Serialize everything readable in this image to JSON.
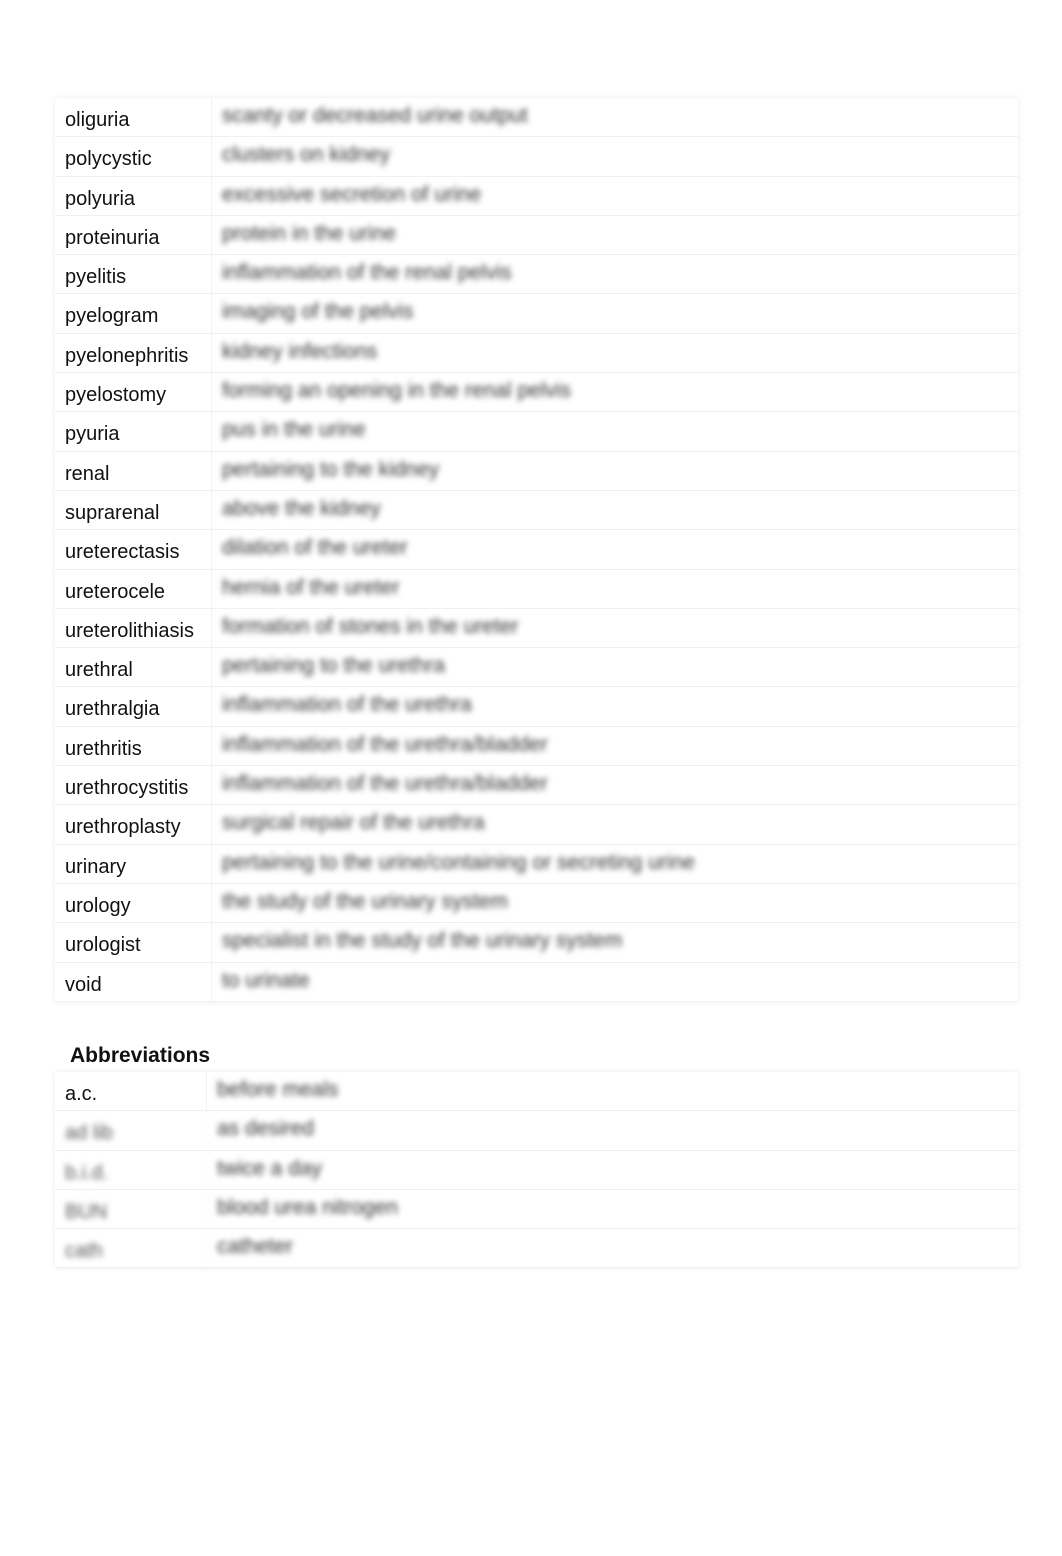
{
  "glossary": [
    {
      "term": "oliguria",
      "definition": "scanty or decreased urine output"
    },
    {
      "term": "polycystic",
      "definition": "clusters on kidney"
    },
    {
      "term": "polyuria",
      "definition": "excessive secretion of urine"
    },
    {
      "term": "proteinuria",
      "definition": "protein in the urine"
    },
    {
      "term": "pyelitis",
      "definition": "inflammation of the renal pelvis"
    },
    {
      "term": "pyelogram",
      "definition": "imaging of the pelvis"
    },
    {
      "term": "pyelonephritis",
      "definition": "kidney infections"
    },
    {
      "term": "pyelostomy",
      "definition": "forming an opening in the renal pelvis"
    },
    {
      "term": "pyuria",
      "definition": "pus in the urine"
    },
    {
      "term": "renal",
      "definition": "pertaining to the kidney"
    },
    {
      "term": "suprarenal",
      "definition": "above the kidney"
    },
    {
      "term": "ureterectasis",
      "definition": "dilation of the ureter"
    },
    {
      "term": "ureterocele",
      "definition": "hernia of the ureter"
    },
    {
      "term": "ureterolithiasis",
      "definition": "formation of stones in the ureter"
    },
    {
      "term": "urethral",
      "definition": "pertaining to the urethra"
    },
    {
      "term": "urethralgia",
      "definition": "inflammation of the urethra"
    },
    {
      "term": "urethritis",
      "definition": "inflammation of the urethra/bladder"
    },
    {
      "term": "urethrocystitis",
      "definition": "inflammation of the urethra/bladder"
    },
    {
      "term": "urethroplasty",
      "definition": "surgical repair of the urethra"
    },
    {
      "term": "urinary",
      "definition": "pertaining to the urine/containing or secreting urine"
    },
    {
      "term": "urology",
      "definition": "the study of the urinary system"
    },
    {
      "term": "urologist",
      "definition": "specialist in the study of the urinary system"
    },
    {
      "term": "void",
      "definition": "to urinate"
    }
  ],
  "abbreviations": {
    "heading": "Abbreviations",
    "items": [
      {
        "term": "a.c.",
        "definition": "before meals",
        "term_blurred": false
      },
      {
        "term": "ad lib",
        "definition": "as desired",
        "term_blurred": true
      },
      {
        "term": "b.i.d.",
        "definition": "twice a day",
        "term_blurred": true
      },
      {
        "term": "BUN",
        "definition": "blood urea nitrogen",
        "term_blurred": true
      },
      {
        "term": "cath",
        "definition": "catheter",
        "term_blurred": true
      }
    ]
  }
}
